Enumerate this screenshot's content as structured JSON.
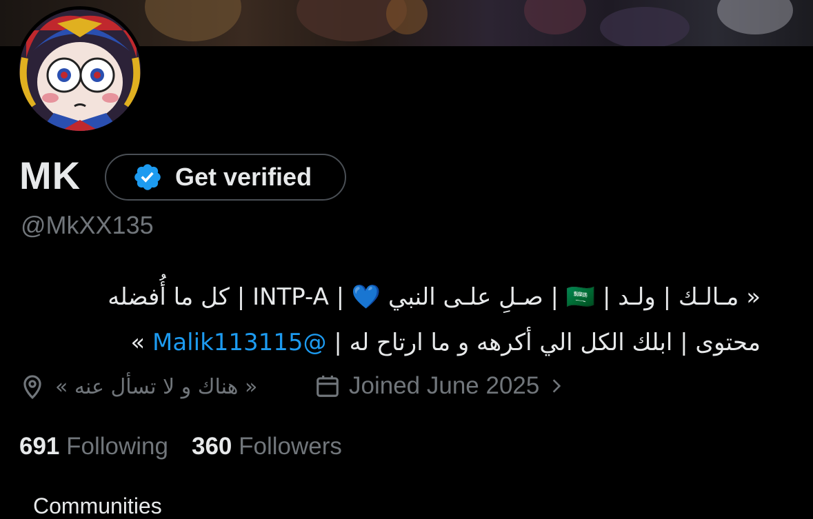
{
  "profile": {
    "name": "MK",
    "get_verified_label": "Get verified",
    "handle": "@MkXX135",
    "bio_line1": "« مـالـك | ولـد | 🇸🇦 | صـلِ علـى النبي 💙 | INTP-A | كل ما أُفضله",
    "bio_line2_text": "محتوى | ابلك الكل الي أكرهه و ما ارتاح له | ",
    "bio_mention": "@Malik113115",
    "bio_line2_end": " »",
    "location": "« هناك و لا تسأل عنه »",
    "joined": "Joined June 2025",
    "following_count": "691",
    "following_label": "Following",
    "followers_count": "360",
    "followers_label": "Followers"
  },
  "tabs": {
    "communities_label": "Communities"
  },
  "colors": {
    "background": "#000000",
    "accent": "#1d9bf0",
    "muted": "#71767b",
    "text": "#e7e9ea"
  },
  "icons": [
    "verified-badge-icon",
    "location-pin-icon",
    "calendar-icon",
    "chevron-right-icon"
  ]
}
